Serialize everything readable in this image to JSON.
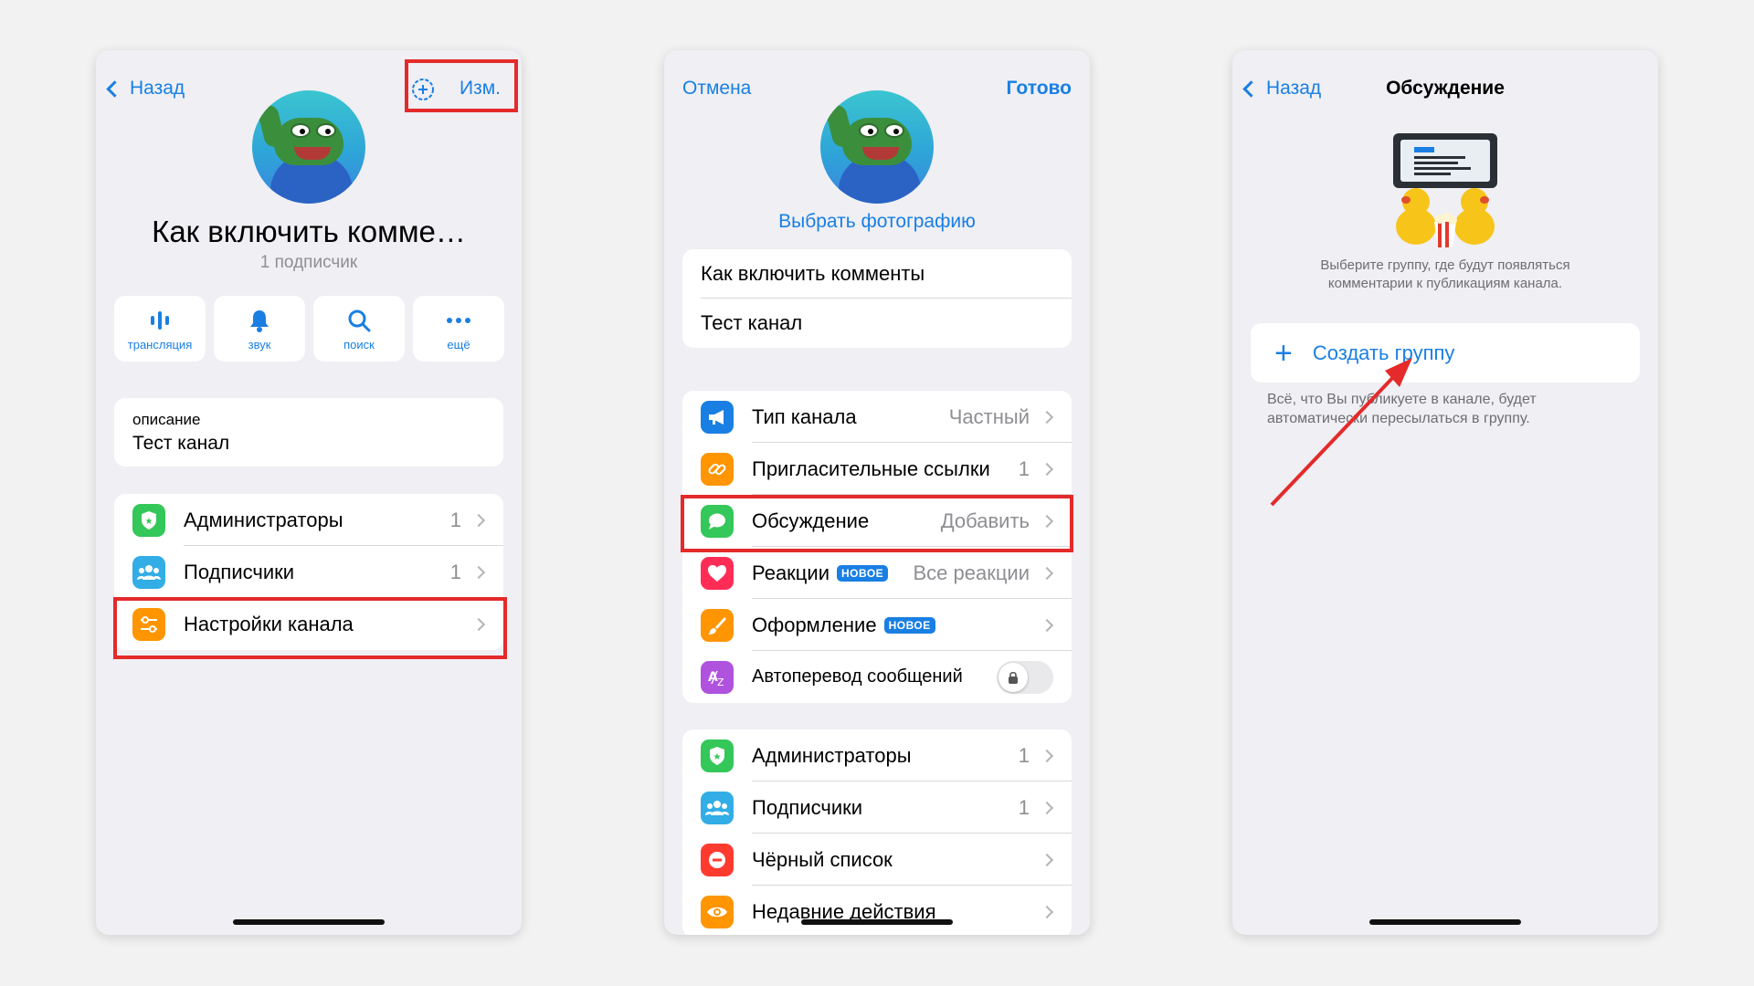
{
  "phone1": {
    "nav": {
      "back_label": "Назад",
      "edit_label": "Изм."
    },
    "channel_title": "Как включить комме…",
    "subscriber_count": "1 подписчик",
    "actions": [
      {
        "icon": "broadcast-icon",
        "label": "трансляция"
      },
      {
        "icon": "bell-icon",
        "label": "звук"
      },
      {
        "icon": "search-icon",
        "label": "поиск"
      },
      {
        "icon": "more-icon",
        "label": "ещё"
      }
    ],
    "description": {
      "caption": "описание",
      "text": "Тест канал"
    },
    "menu": [
      {
        "label": "Администраторы",
        "value": "1",
        "icon": "admin-shield-icon",
        "color": "#34c759"
      },
      {
        "label": "Подписчики",
        "value": "1",
        "icon": "people-icon",
        "color": "#32ade6"
      },
      {
        "label": "Настройки канала",
        "value": "",
        "icon": "settings-sliders-icon",
        "color": "#ff9500"
      }
    ]
  },
  "phone2": {
    "nav": {
      "cancel_label": "Отмена",
      "done_label": "Готово"
    },
    "choose_photo": "Выбрать фотографию",
    "fields": {
      "name": "Как включить комменты",
      "description": "Тест канал"
    },
    "settings": [
      {
        "label": "Тип канала",
        "value": "Частный",
        "badge": "",
        "icon": "megaphone-icon",
        "color": "#1a7fe3"
      },
      {
        "label": "Пригласительные ссылки",
        "value": "1",
        "badge": "",
        "icon": "link-icon",
        "color": "#ff9500"
      },
      {
        "label": "Обсуждение",
        "value": "Добавить",
        "badge": "",
        "icon": "chat-bubble-icon",
        "color": "#34c759"
      },
      {
        "label": "Реакции",
        "value": "Все реакции",
        "badge": "НОВОЕ",
        "icon": "heart-icon",
        "color": "#ff2d55"
      },
      {
        "label": "Оформление",
        "value": "",
        "badge": "НОВОЕ",
        "icon": "brush-icon",
        "color": "#ff9500"
      }
    ],
    "autotranslate_label": "Автоперевод сообщений",
    "admin": [
      {
        "label": "Администраторы",
        "value": "1",
        "icon": "admin-shield-icon",
        "color": "#34c759"
      },
      {
        "label": "Подписчики",
        "value": "1",
        "icon": "people-icon",
        "color": "#32ade6"
      },
      {
        "label": "Чёрный список",
        "value": "",
        "icon": "blocked-icon",
        "color": "#ff3b30"
      },
      {
        "label": "Недавние действия",
        "value": "",
        "icon": "eye-icon",
        "color": "#ff9500"
      }
    ]
  },
  "phone3": {
    "nav": {
      "back_label": "Назад",
      "title": "Обсуждение"
    },
    "intro_text": "Выберите группу, где будут появляться комментарии к публикациям канала.",
    "create_group_label": "Создать группу",
    "footer_note": "Всё, что Вы публикуете в канале, будет автоматически пересылаться в группу."
  },
  "colors": {
    "accent": "#1a7fe3",
    "highlight": "#e42a2a",
    "background": "#efeff4"
  }
}
